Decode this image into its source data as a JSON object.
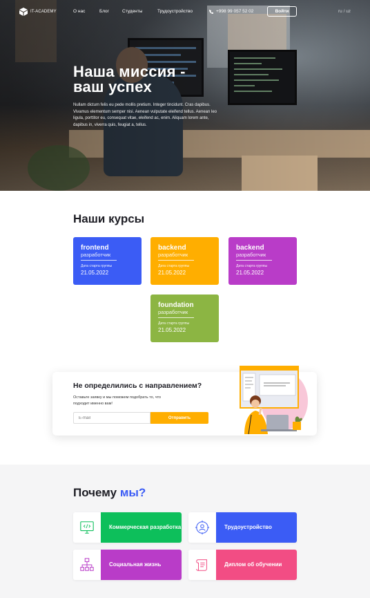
{
  "brand": {
    "name": "IT-ACADEMY"
  },
  "nav": {
    "items": [
      "О нас",
      "Блог",
      "Студенты",
      "Трудоустройство"
    ],
    "phone": "+998 99 057 52 02",
    "login_label": "Войти",
    "lang": "ru / uz"
  },
  "hero": {
    "title_line1": "Наша миссия -",
    "title_line2": "ваш успех",
    "text": "Nullam dictum felis eu pede mollis pretium. Integer tincidunt. Cras dapibus. Vivamus elementum semper nisi. Aenean vulputate eleifend tellus. Aenean leo ligula, porttitor eu, consequat vitae, eleifend ac, enim. Aliquam lorem ante, dapibus in, viverra quis, feugiat a, tellus."
  },
  "courses": {
    "title": "Наши курсы",
    "start_label": "Дата старта группы",
    "items": [
      {
        "name": "frontend",
        "role": "разработчик",
        "date": "21.05.2022",
        "color": "#3b5cf5"
      },
      {
        "name": "backend",
        "role": "разработчик",
        "date": "21.05.2022",
        "color": "#ffae00"
      },
      {
        "name": "backend",
        "role": "разработчик",
        "date": "21.05.2022",
        "color": "#b93cc8"
      },
      {
        "name": "foundation",
        "role": "разработчик",
        "date": "21.05.2022",
        "color": "#8cb543"
      }
    ]
  },
  "cta": {
    "title": "Не определились с направлением?",
    "text": "Оставьте заявку и мы поможем подобрать то, что подходит именно вам!",
    "input_placeholder": "E-mail",
    "button_label": "Отправить"
  },
  "why": {
    "title_main": "Почему",
    "title_accent": "мы?",
    "items": [
      {
        "label": "Коммерческая разработка",
        "color": "#0dbf5b",
        "icon": "monitor-code-icon"
      },
      {
        "label": "Трудоустройство",
        "color": "#3b5cf5",
        "icon": "person-target-icon"
      },
      {
        "label": "Социальная жизнь",
        "color": "#b93cc8",
        "icon": "network-icon"
      },
      {
        "label": "Диплом об обучении",
        "color": "#f24d84",
        "icon": "scroll-icon"
      }
    ]
  }
}
